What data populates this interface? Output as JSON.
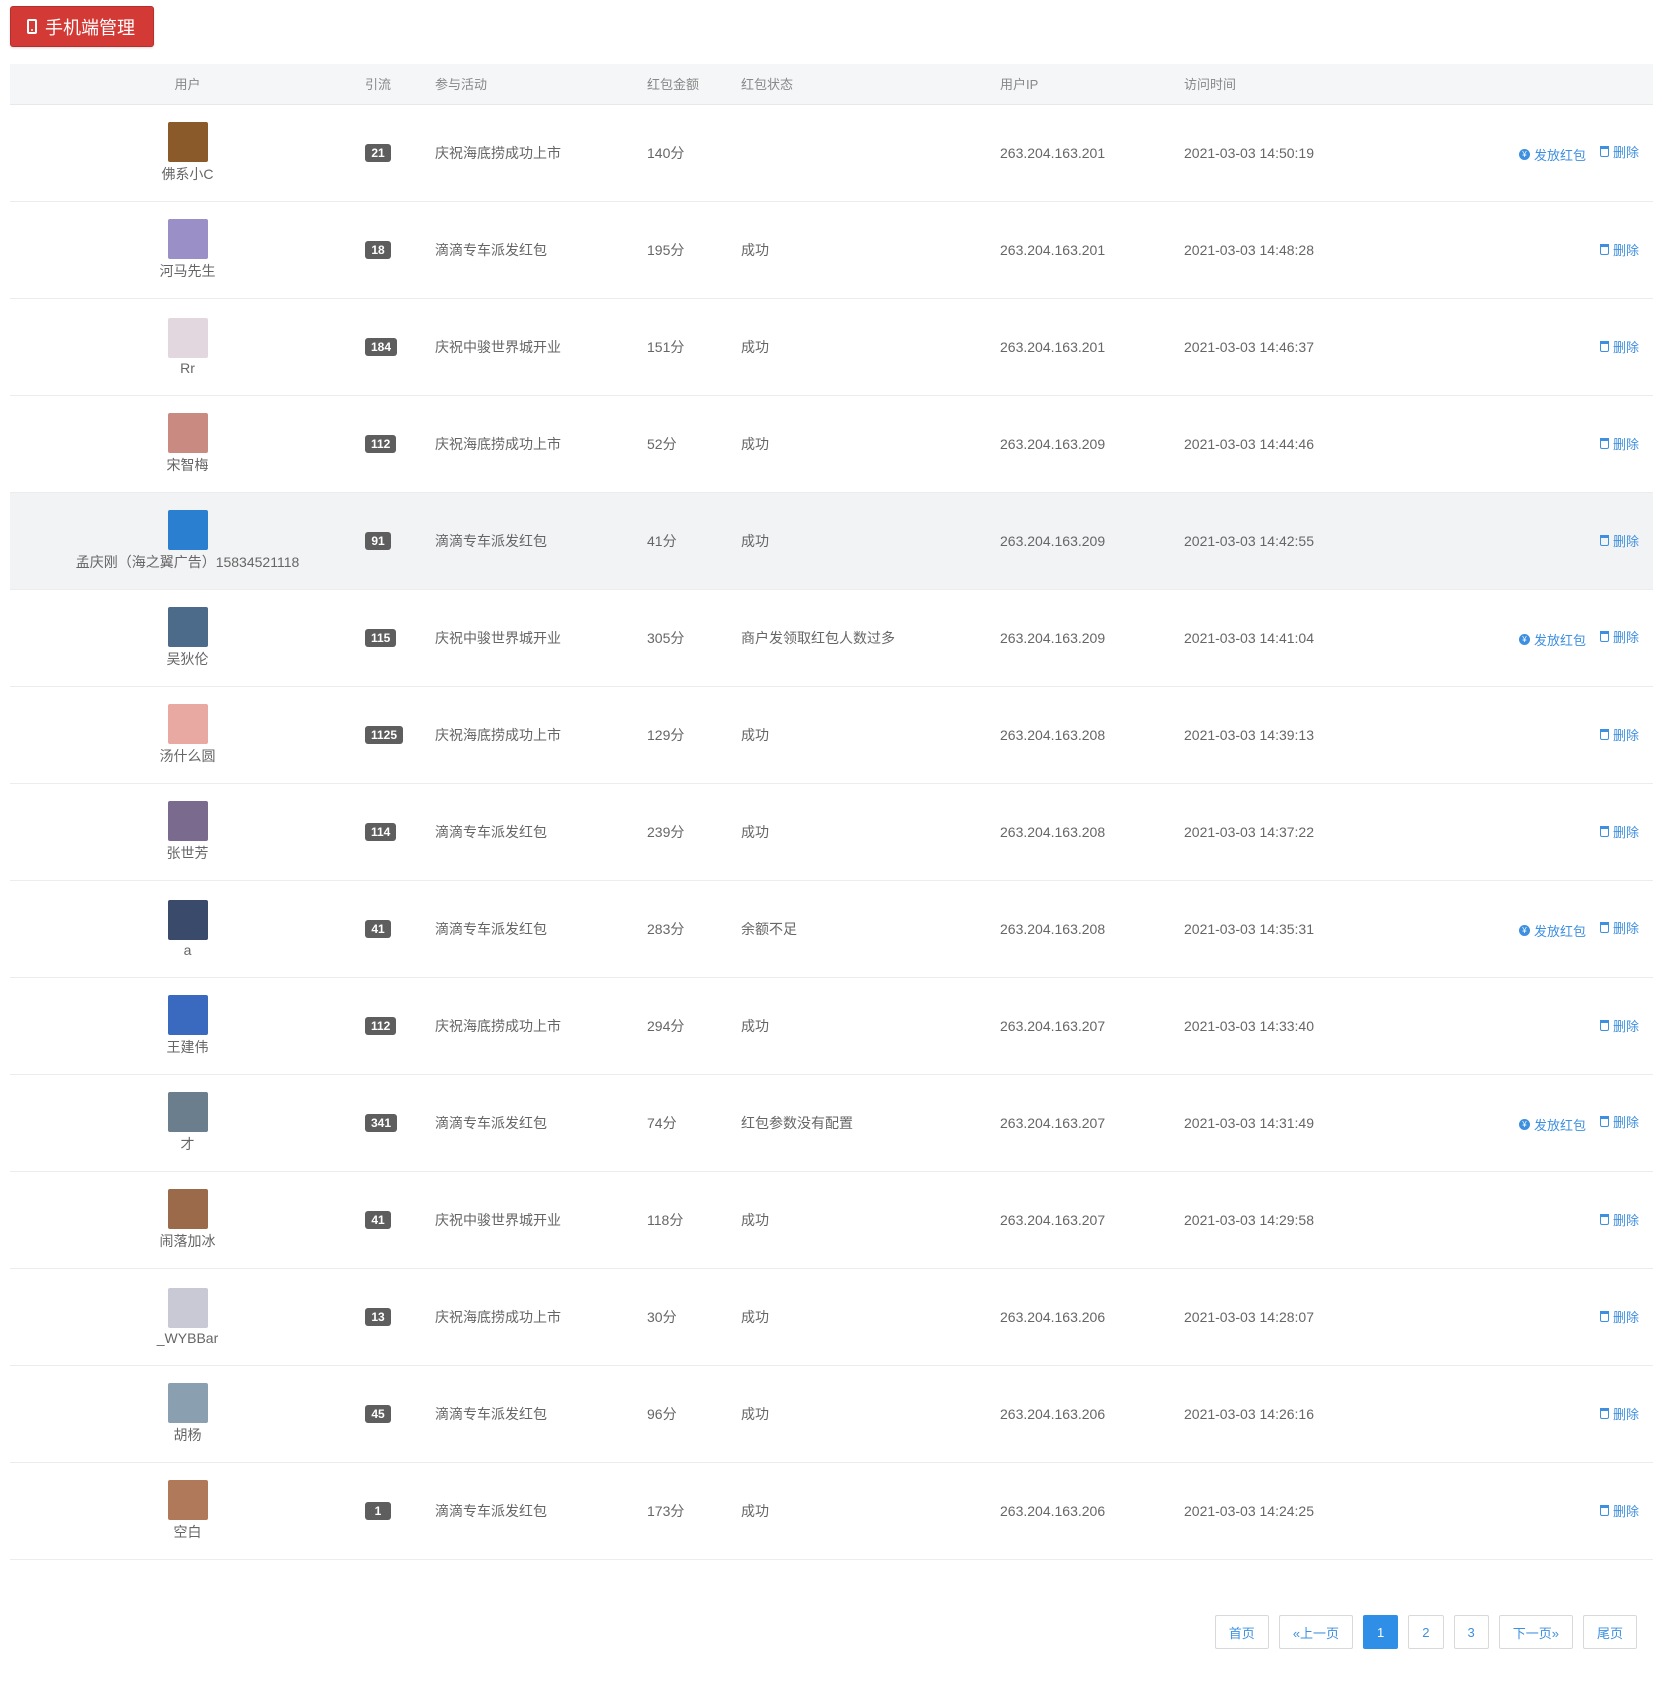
{
  "header": {
    "title": "手机端管理",
    "icon": "mobile-phone-icon"
  },
  "table": {
    "columns": [
      "用户",
      "引流",
      "参与活动",
      "红包金额",
      "红包状态",
      "用户IP",
      "访问时间",
      ""
    ],
    "rows": [
      {
        "user": "佛系小C",
        "ref": "21",
        "activity": "庆祝海底捞成功上市",
        "amount": "140分",
        "status": "",
        "ip": "263.204.163.201",
        "time": "2021-03-03 14:50:19",
        "send": "发放红包",
        "del": "删除",
        "avatar": "#8a5a2a"
      },
      {
        "user": "河马先生",
        "ref": "18",
        "activity": "滴滴专车派发红包",
        "amount": "195分",
        "status": "成功",
        "ip": "263.204.163.201",
        "time": "2021-03-03 14:48:28",
        "send": "",
        "del": "删除",
        "avatar": "#9a8fc6"
      },
      {
        "user": "Rr",
        "ref": "184",
        "activity": "庆祝中骏世界城开业",
        "amount": "151分",
        "status": "成功",
        "ip": "263.204.163.201",
        "time": "2021-03-03 14:46:37",
        "send": "",
        "del": "删除",
        "avatar": "#e2d7df"
      },
      {
        "user": "宋智梅",
        "ref": "112",
        "activity": "庆祝海底捞成功上市",
        "amount": "52分",
        "status": "成功",
        "ip": "263.204.163.209",
        "time": "2021-03-03 14:44:46",
        "send": "",
        "del": "删除",
        "avatar": "#c98a82"
      },
      {
        "user": "孟庆刚（海之翼广告）15834521118",
        "ref": "91",
        "activity": "滴滴专车派发红包",
        "amount": "41分",
        "status": "成功",
        "ip": "263.204.163.209",
        "time": "2021-03-03 14:42:55",
        "send": "",
        "del": "删除",
        "avatar": "#2a7fd0",
        "highlight": true
      },
      {
        "user": "吴狄伦",
        "ref": "115",
        "activity": "庆祝中骏世界城开业",
        "amount": "305分",
        "status": "商户发领取红包人数过多",
        "ip": "263.204.163.209",
        "time": "2021-03-03 14:41:04",
        "send": "发放红包",
        "del": "删除",
        "avatar": "#4c6a8a"
      },
      {
        "user": "汤什么圆",
        "ref": "1125",
        "activity": "庆祝海底捞成功上市",
        "amount": "129分",
        "status": "成功",
        "ip": "263.204.163.208",
        "time": "2021-03-03 14:39:13",
        "send": "",
        "del": "删除",
        "avatar": "#e8a9a3"
      },
      {
        "user": "张世芳",
        "ref": "114",
        "activity": "滴滴专车派发红包",
        "amount": "239分",
        "status": "成功",
        "ip": "263.204.163.208",
        "time": "2021-03-03 14:37:22",
        "send": "",
        "del": "删除",
        "avatar": "#7a6a8e"
      },
      {
        "user": "a",
        "ref": "41",
        "activity": "滴滴专车派发红包",
        "amount": "283分",
        "status": "余额不足",
        "ip": "263.204.163.208",
        "time": "2021-03-03 14:35:31",
        "send": "发放红包",
        "del": "删除",
        "avatar": "#3a4a6a"
      },
      {
        "user": "王建伟",
        "ref": "112",
        "activity": "庆祝海底捞成功上市",
        "amount": "294分",
        "status": "成功",
        "ip": "263.204.163.207",
        "time": "2021-03-03 14:33:40",
        "send": "",
        "del": "删除",
        "avatar": "#3a6ac0"
      },
      {
        "user": "才",
        "ref": "341",
        "activity": "滴滴专车派发红包",
        "amount": "74分",
        "status": "红包参数没有配置",
        "ip": "263.204.163.207",
        "time": "2021-03-03 14:31:49",
        "send": "发放红包",
        "del": "删除",
        "avatar": "#6a7e8e"
      },
      {
        "user": "闹落加冰",
        "ref": "41",
        "activity": "庆祝中骏世界城开业",
        "amount": "118分",
        "status": "成功",
        "ip": "263.204.163.207",
        "time": "2021-03-03 14:29:58",
        "send": "",
        "del": "删除",
        "avatar": "#9a6a4a"
      },
      {
        "user": "_WYBBar",
        "ref": "13",
        "activity": "庆祝海底捞成功上市",
        "amount": "30分",
        "status": "成功",
        "ip": "263.204.163.206",
        "time": "2021-03-03 14:28:07",
        "send": "",
        "del": "删除",
        "avatar": "#c9c9d6"
      },
      {
        "user": "胡杨",
        "ref": "45",
        "activity": "滴滴专车派发红包",
        "amount": "96分",
        "status": "成功",
        "ip": "263.204.163.206",
        "time": "2021-03-03 14:26:16",
        "send": "",
        "del": "删除",
        "avatar": "#8aa0b0"
      },
      {
        "user": "空白",
        "ref": "1",
        "activity": "滴滴专车派发红包",
        "amount": "173分",
        "status": "成功",
        "ip": "263.204.163.206",
        "time": "2021-03-03 14:24:25",
        "send": "",
        "del": "删除",
        "avatar": "#b07a5a"
      }
    ]
  },
  "pagination": {
    "first": "首页",
    "prev": "«上一页",
    "pages": [
      "1",
      "2",
      "3"
    ],
    "active": "1",
    "next": "下一页»",
    "last": "尾页"
  },
  "colors": {
    "accent": "#3d8fe0",
    "header_button": "#d33a36",
    "badge": "#5e5e5e"
  }
}
